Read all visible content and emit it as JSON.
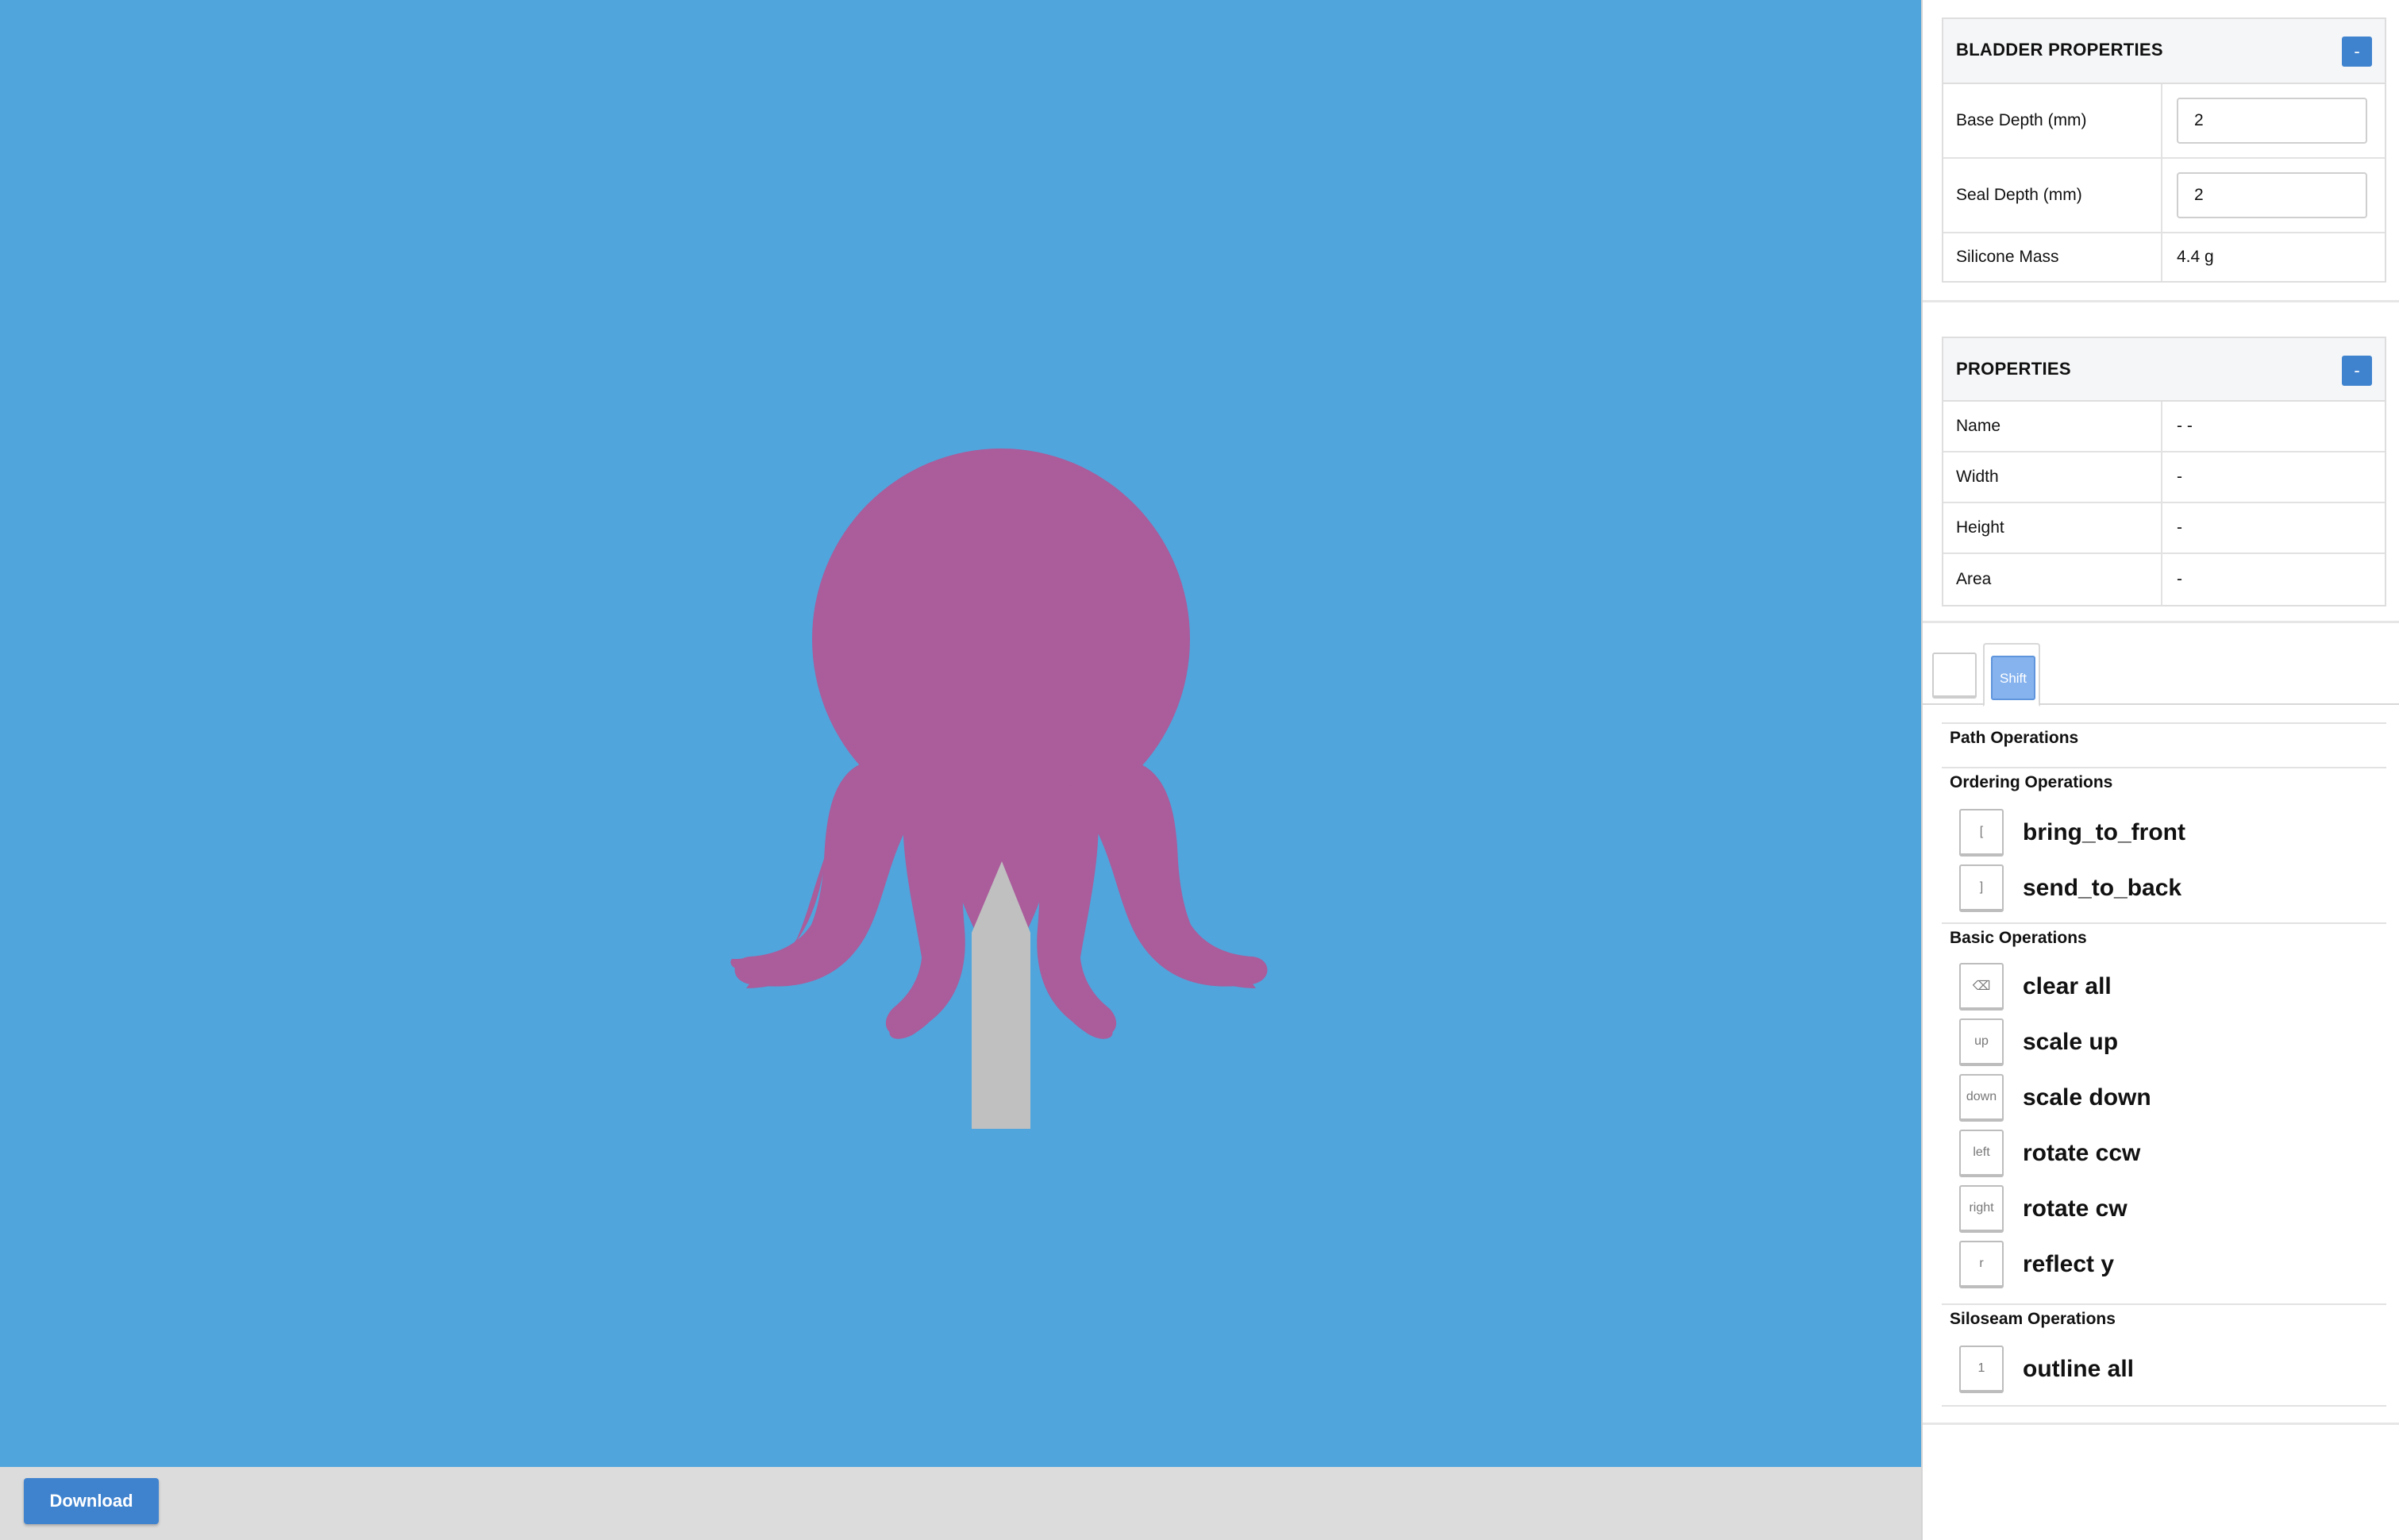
{
  "canvas": {
    "background": "#50a5dc",
    "shape_color": "#aa5c9b",
    "stem_color": "#c0c0c0"
  },
  "bottom_bar": {
    "download_label": "Download"
  },
  "bladder_properties": {
    "title": "BLADDER PROPERTIES",
    "collapse_label": "-",
    "rows": [
      {
        "label": "Base Depth (mm)",
        "value": "2"
      },
      {
        "label": "Seal Depth (mm)",
        "value": "2"
      },
      {
        "label": "Silicone Mass",
        "value": "4.4 g"
      }
    ]
  },
  "properties": {
    "title": "PROPERTIES",
    "collapse_label": "-",
    "rows": [
      {
        "label": "Name",
        "value": "- -"
      },
      {
        "label": "Width",
        "value": "-"
      },
      {
        "label": "Height",
        "value": "-"
      },
      {
        "label": "Area",
        "value": "-"
      }
    ]
  },
  "tabs": {
    "shift_label": "Shift"
  },
  "operations": {
    "path_title": "Path Operations",
    "ordering_title": "Ordering Operations",
    "ordering": [
      {
        "key": "[",
        "label": "bring_to_front"
      },
      {
        "key": "]",
        "label": "send_to_back"
      }
    ],
    "basic_title": "Basic Operations",
    "basic": [
      {
        "key": "⌫",
        "label": "clear all"
      },
      {
        "key": "up",
        "label": "scale up"
      },
      {
        "key": "down",
        "label": "scale down"
      },
      {
        "key": "left",
        "label": "rotate ccw"
      },
      {
        "key": "right",
        "label": "rotate cw"
      },
      {
        "key": "r",
        "label": "reflect y"
      }
    ],
    "siloseam_title": "Siloseam Operations",
    "siloseam": [
      {
        "key": "1",
        "label": "outline all"
      }
    ]
  }
}
